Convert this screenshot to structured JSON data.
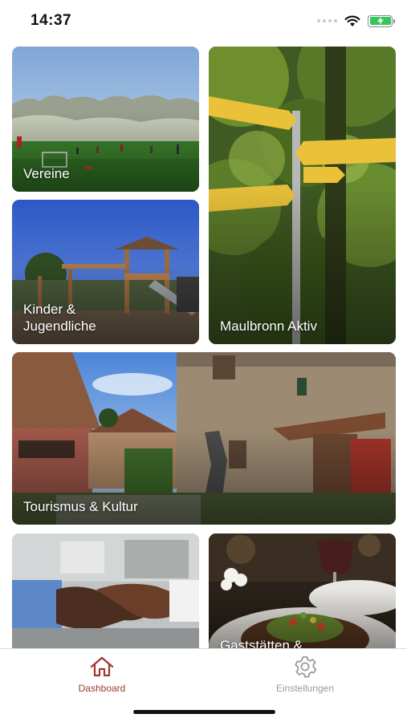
{
  "status_bar": {
    "time": "14:37",
    "icons": [
      "signal-dots-icon",
      "wifi-icon",
      "battery-charging-icon"
    ],
    "battery_color": "#35c759"
  },
  "tiles": [
    {
      "label": "Vereine",
      "image": "soccer-field-photo"
    },
    {
      "label": "Maulbronn Aktiv",
      "image": "hiking-signpost-photo"
    },
    {
      "label": "Kinder &\nJugendliche",
      "image": "playground-photo"
    },
    {
      "label": "Tourismus & Kultur",
      "image": "monastery-courtyard-photo"
    },
    {
      "label": "",
      "image": "handshake-photo"
    },
    {
      "label": "Gaststätten &",
      "image": "restaurant-dish-photo"
    }
  ],
  "tab_bar": {
    "tabs": [
      {
        "label": "Dashboard",
        "icon": "home-icon",
        "active": true
      },
      {
        "label": "Einstellungen",
        "icon": "gear-icon",
        "active": false
      }
    ],
    "active_color": "#a0392e",
    "inactive_color": "#9b9b9b"
  }
}
